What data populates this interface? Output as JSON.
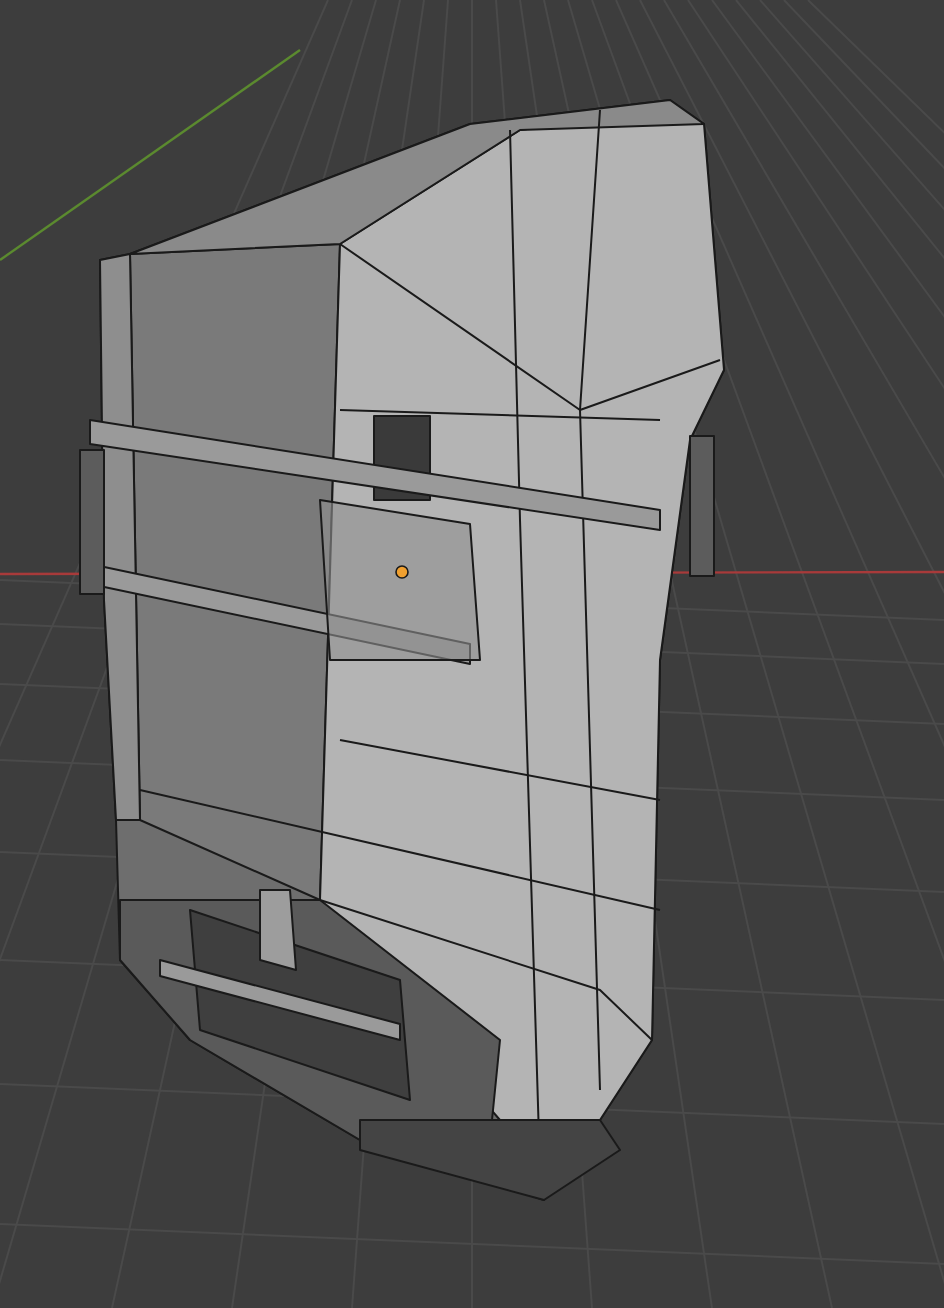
{
  "viewport": {
    "show_origin": true
  }
}
